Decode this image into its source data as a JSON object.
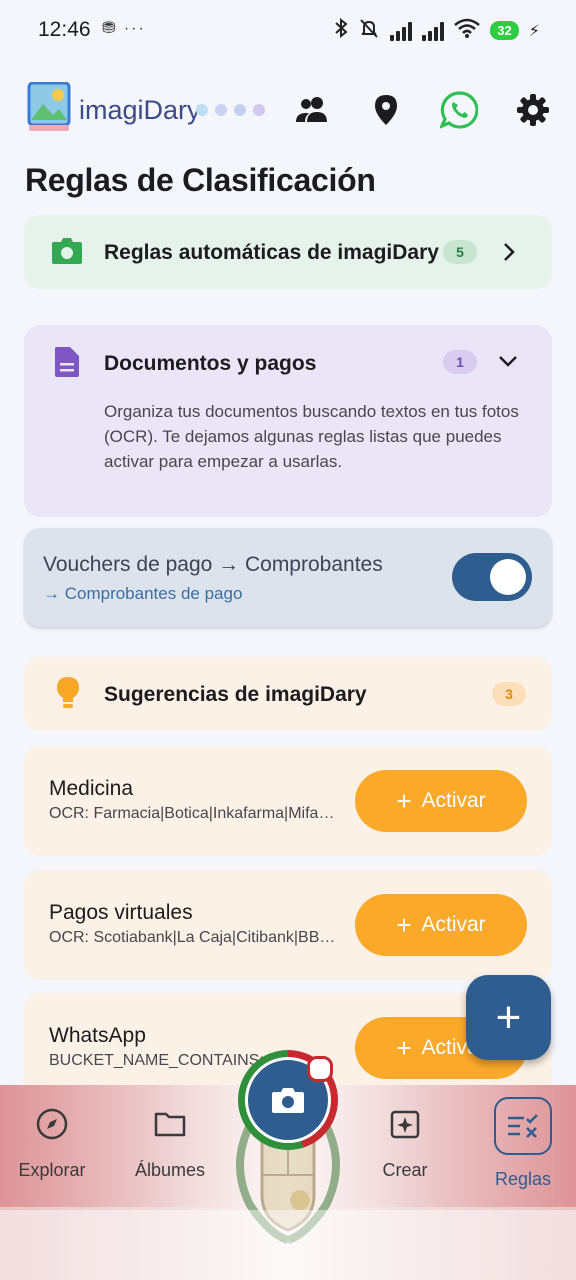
{
  "status": {
    "time": "12:46",
    "left_icons": "⛃ ···",
    "battery": "32",
    "icons": [
      "bluetooth-icon",
      "mute-icon",
      "signal-icon",
      "signal-icon",
      "wifi-icon",
      "battery-icon",
      "charging-icon"
    ]
  },
  "header": {
    "logo_text": "imagiDary",
    "icons": [
      "people-icon",
      "location-pin-icon",
      "whatsapp-icon",
      "gear-icon"
    ],
    "dot_colors": [
      "#bcdff2",
      "#cbd3f3",
      "#c3d0f0",
      "#d3c8ef"
    ]
  },
  "page": {
    "title": "Reglas de Clasificación"
  },
  "auto_rules": {
    "label": "Reglas automáticas de imagiDary",
    "count": "5",
    "icon": "camera-icon"
  },
  "docs": {
    "label": "Documentos y pagos",
    "count": "1",
    "icon": "document-icon",
    "description": "Organiza tus documentos buscando textos en tus fotos (OCR). Te dejamos algunas reglas listas que puedes activar para empezar a usarlas."
  },
  "voucher_rule": {
    "title": "Vouchers de pago → Comprobantes",
    "subtitle": "→ Comprobantes de pago",
    "enabled": true
  },
  "suggestions": {
    "label": "Sugerencias de imagiDary",
    "count": "3",
    "icon": "lightbulb-icon"
  },
  "suggested_rules": [
    {
      "title": "Medicina",
      "subtitle": "OCR: Farmacia|Botica|Inkafarma|Mifarma",
      "button": "Activar"
    },
    {
      "title": "Pagos virtuales",
      "subtitle": "OCR: Scotiabank|La Caja|Citibank|BBVA",
      "button": "Activar"
    },
    {
      "title": "WhatsApp",
      "subtitle": "BUCKET_NAME_CONTAINS: WhatsApp",
      "button": "Activar"
    }
  ],
  "fab": {
    "symbol": "+"
  },
  "bottom_nav": {
    "items": [
      {
        "label": "Explorar",
        "icon": "compass-icon"
      },
      {
        "label": "Álbumes",
        "icon": "folder-icon"
      },
      {
        "label": "Crear",
        "icon": "sparkle-image-icon"
      },
      {
        "label": "Reglas",
        "icon": "rules-icon",
        "active": true
      }
    ]
  },
  "colors": {
    "accent": "#2f5d8f",
    "activate_button": "#fba92a",
    "auto_card": "#e6f3ea",
    "docs_card": "#ebe6f7",
    "suggestion_card": "#fbf1e6"
  }
}
